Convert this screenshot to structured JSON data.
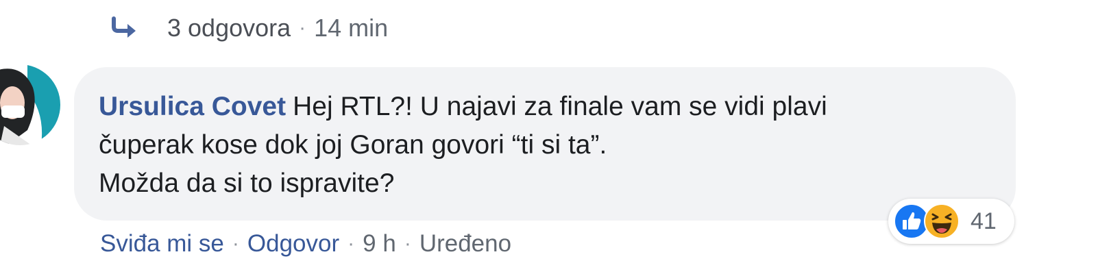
{
  "replies": {
    "count_label": "3 odgovora",
    "separator": "·",
    "time": "14 min",
    "icon": "reply-arrow-icon"
  },
  "comment": {
    "avatar_icon": "user-avatar",
    "author": "Ursulica Covet",
    "lines": [
      "Hej RTL?! U najavi za finale vam se vidi plavi",
      "čuperak kose dok joj Goran govori “ti si ta”.",
      "Možda da si to ispravite?"
    ],
    "bubble_color": "#f2f3f5",
    "author_color": "#385898"
  },
  "reactions": {
    "icons": [
      "like-icon",
      "haha-icon"
    ],
    "count": "41",
    "like_color": "#1877f2",
    "haha_color": "#f7b125"
  },
  "actions": {
    "like_label": "Sviđa mi se",
    "reply_label": "Odgovor",
    "time": "9 h",
    "edited_label": "Uređeno",
    "separator": "·"
  }
}
